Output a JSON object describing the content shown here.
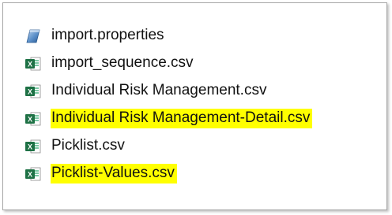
{
  "files": [
    {
      "name": "import.properties",
      "icon": "properties-file-icon",
      "highlighted": false
    },
    {
      "name": "import_sequence.csv",
      "icon": "excel-csv-icon",
      "highlighted": false
    },
    {
      "name": "Individual Risk Management.csv",
      "icon": "excel-csv-icon",
      "highlighted": false
    },
    {
      "name": "Individual Risk Management-Detail.csv",
      "icon": "excel-csv-icon",
      "highlighted": true
    },
    {
      "name": "Picklist.csv",
      "icon": "excel-csv-icon",
      "highlighted": false
    },
    {
      "name": "Picklist-Values.csv",
      "icon": "excel-csv-icon",
      "highlighted": true
    }
  ],
  "colors": {
    "highlight": "#ffff00",
    "excel_green": "#1e7145",
    "properties_blue": "#3d6fa8"
  }
}
